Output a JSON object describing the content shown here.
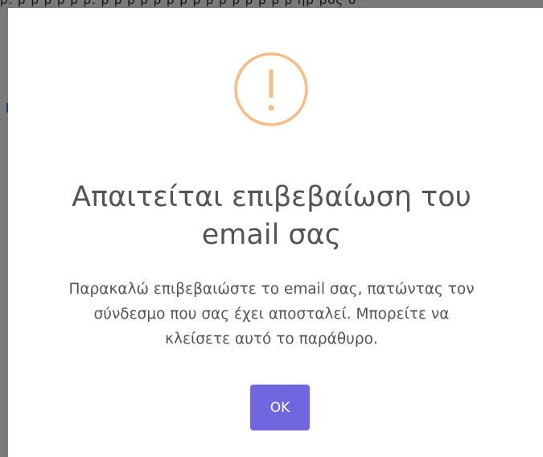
{
  "backdrop": {
    "cut_text": "ρ. ρ ρ ρ ρ ρ ρ. ρ ρ ρ ρ   ρ ρ ρ ρ ρ ρ ρ ρ ρ ρ ρ   ηρ ρος σ"
  },
  "dialog": {
    "icon": "warning-exclamation-icon",
    "icon_color": "#f8bb86",
    "title_line1": "Απαιτείται επιβεβαίωση του",
    "title_line2": "email σας",
    "message_line1": "Παρακαλώ επιβεβαιώστε το email σας, πατώντας τον",
    "message_line2": "σύνδεσμο που σας έχει αποσταλεί. Μπορείτε να",
    "message_line3": "κλείσετε αυτό το παράθυρο.",
    "confirm_label": "OK",
    "confirm_color": "#7066e0"
  }
}
